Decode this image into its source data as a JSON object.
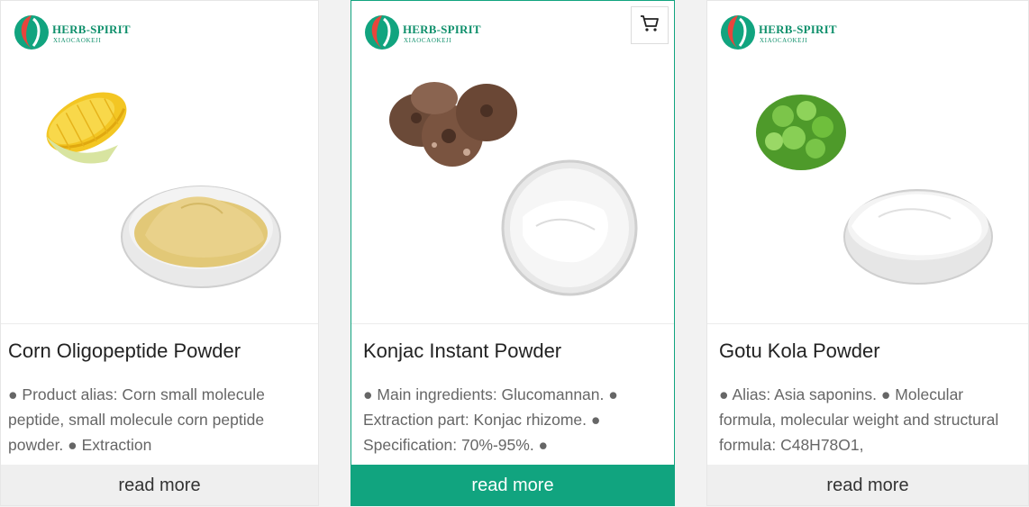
{
  "brand": {
    "name": "HERB-SPIRIT",
    "sub": "XIAOCAOKEJI"
  },
  "colors": {
    "accent": "#11a47f",
    "brand_green": "#10906c"
  },
  "products": [
    {
      "title": "Corn Oligopeptide Powder",
      "description": "● Product alias: Corn small molecule peptide, small molecule corn peptide powder. ● Extraction",
      "read_more": "read more",
      "active": false
    },
    {
      "title": "Konjac Instant Powder",
      "description": "● Main ingredients: Glucomannan. ● Extraction part: Konjac rhizome. ● Specification: 70%-95%. ●",
      "read_more": "read more",
      "active": true,
      "cart_icon": "cart-icon"
    },
    {
      "title": "Gotu Kola Powder",
      "description": "● Alias: Asia saponins. ● Molecular formula, molecular weight and structural formula: C48H78O1,",
      "read_more": "read more",
      "active": false
    }
  ]
}
